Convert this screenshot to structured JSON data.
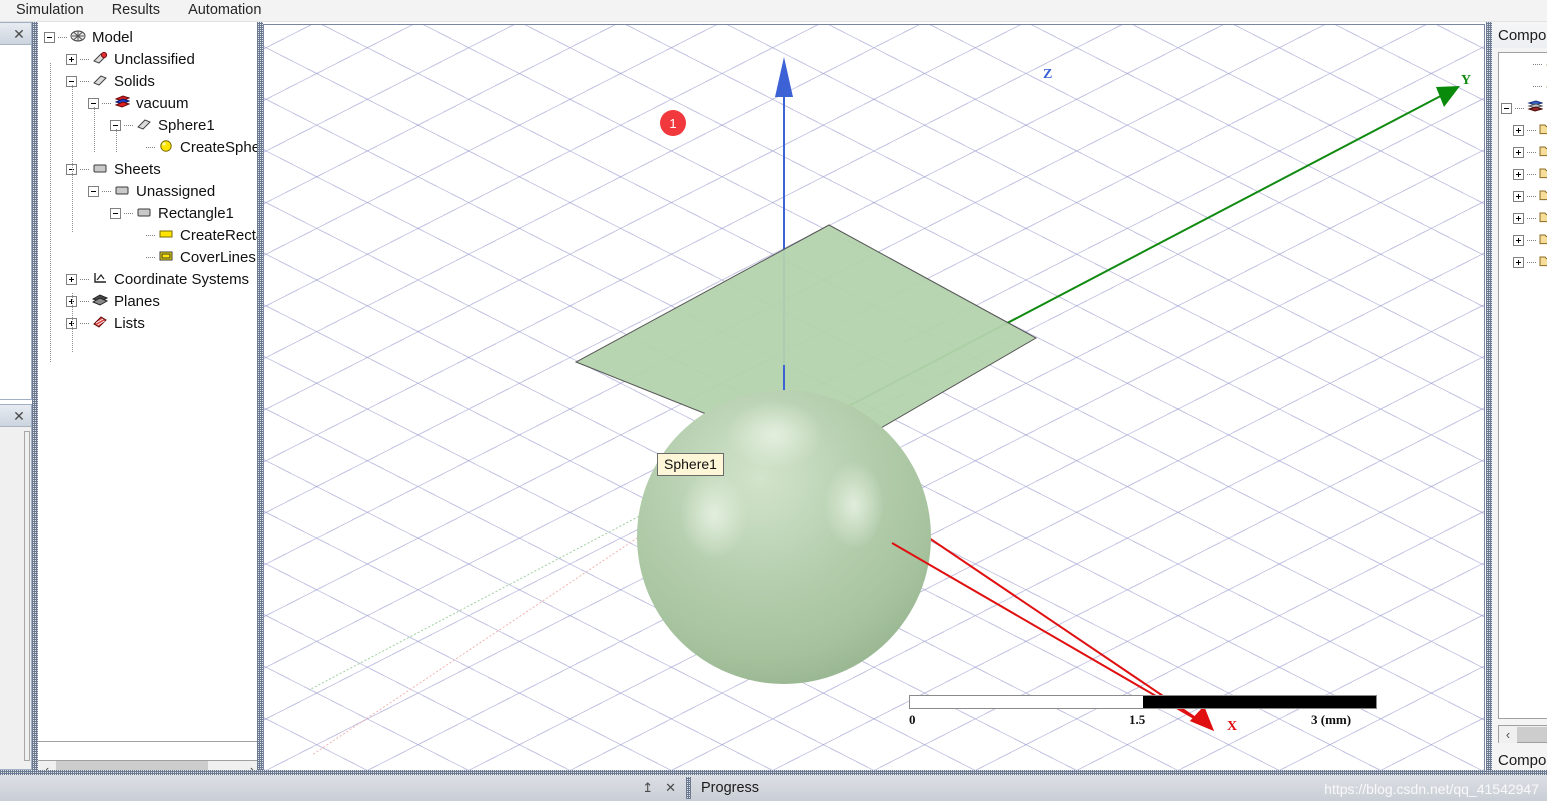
{
  "menubar": {
    "items": [
      {
        "label": "Simulation",
        "name": "menu-simulation"
      },
      {
        "label": "Results",
        "name": "menu-results"
      },
      {
        "label": "Automation",
        "name": "menu-automation"
      }
    ]
  },
  "left_panels": {
    "top": {
      "close_label": "✕",
      "pin_label": "–"
    },
    "bottom": {
      "close_label": "✕",
      "pin_label": "–"
    }
  },
  "tree": {
    "nodes": [
      {
        "label": "Model",
        "depth": 0,
        "toggle": "minus",
        "icon": "model-icon"
      },
      {
        "label": "Unclassified",
        "depth": 1,
        "toggle": "plus",
        "icon": "unclassified-icon"
      },
      {
        "label": "Solids",
        "depth": 1,
        "toggle": "minus",
        "icon": "solid-icon"
      },
      {
        "label": "vacuum",
        "depth": 2,
        "toggle": "minus",
        "icon": "material-icon"
      },
      {
        "label": "Sphere1",
        "depth": 3,
        "toggle": "minus",
        "icon": "solid-icon"
      },
      {
        "label": "CreateSphe",
        "depth": 4,
        "toggle": "none",
        "icon": "command-sphere-icon"
      },
      {
        "label": "Sheets",
        "depth": 1,
        "toggle": "minus",
        "icon": "sheet-icon"
      },
      {
        "label": "Unassigned",
        "depth": 2,
        "toggle": "minus",
        "icon": "sheet-icon"
      },
      {
        "label": "Rectangle1",
        "depth": 3,
        "toggle": "minus",
        "icon": "sheet-icon"
      },
      {
        "label": "CreateRectą",
        "depth": 4,
        "toggle": "none",
        "icon": "command-rect-icon"
      },
      {
        "label": "CoverLines",
        "depth": 4,
        "toggle": "none",
        "icon": "command-cover-icon"
      },
      {
        "label": "Coordinate Systems",
        "depth": 1,
        "toggle": "plus",
        "icon": "coordinate-systems-icon"
      },
      {
        "label": "Planes",
        "depth": 1,
        "toggle": "plus",
        "icon": "planes-icon"
      },
      {
        "label": "Lists",
        "depth": 1,
        "toggle": "plus",
        "icon": "lists-icon"
      }
    ],
    "scroll": {
      "left_arrow": "‹",
      "right_arrow": "›"
    }
  },
  "viewport": {
    "badge": "1",
    "sphere_label": "Sphere1",
    "axes": [
      {
        "name": "z",
        "label": "Z",
        "color": "#3c62d6"
      },
      {
        "name": "y",
        "label": "Y",
        "color": "#108a10"
      },
      {
        "name": "x",
        "label": "X",
        "color": "#e01010"
      }
    ],
    "scalebar": {
      "ticks": [
        "0",
        "1.5",
        "3 (mm)"
      ]
    },
    "colors": {
      "grid": "#9696cd",
      "sphere": "#a9c6a2",
      "sheet": "#b5d3ae",
      "badge": "#f1383c"
    }
  },
  "right_panel": {
    "title": "Compon",
    "tab_label": "Compo",
    "rows": [
      {
        "toggle": "none",
        "icon": "param-icon"
      },
      {
        "toggle": "none",
        "icon": "param-icon"
      },
      {
        "toggle": "minus",
        "icon": "library-icon"
      },
      {
        "toggle": "plus",
        "icon": "folder-icon"
      },
      {
        "toggle": "plus",
        "icon": "folder-icon"
      },
      {
        "toggle": "plus",
        "icon": "folder-icon"
      },
      {
        "toggle": "plus",
        "icon": "folder-icon"
      },
      {
        "toggle": "plus",
        "icon": "folder-icon"
      },
      {
        "toggle": "plus",
        "icon": "folder-icon"
      },
      {
        "toggle": "plus",
        "icon": "folder-icon"
      }
    ],
    "scroll": {
      "left_arrow": "‹"
    }
  },
  "statusbar": {
    "pin_label": "↥",
    "close_label": "✕",
    "progress_label": "Progress"
  },
  "watermark": "https://blog.csdn.net/qq_41542947"
}
